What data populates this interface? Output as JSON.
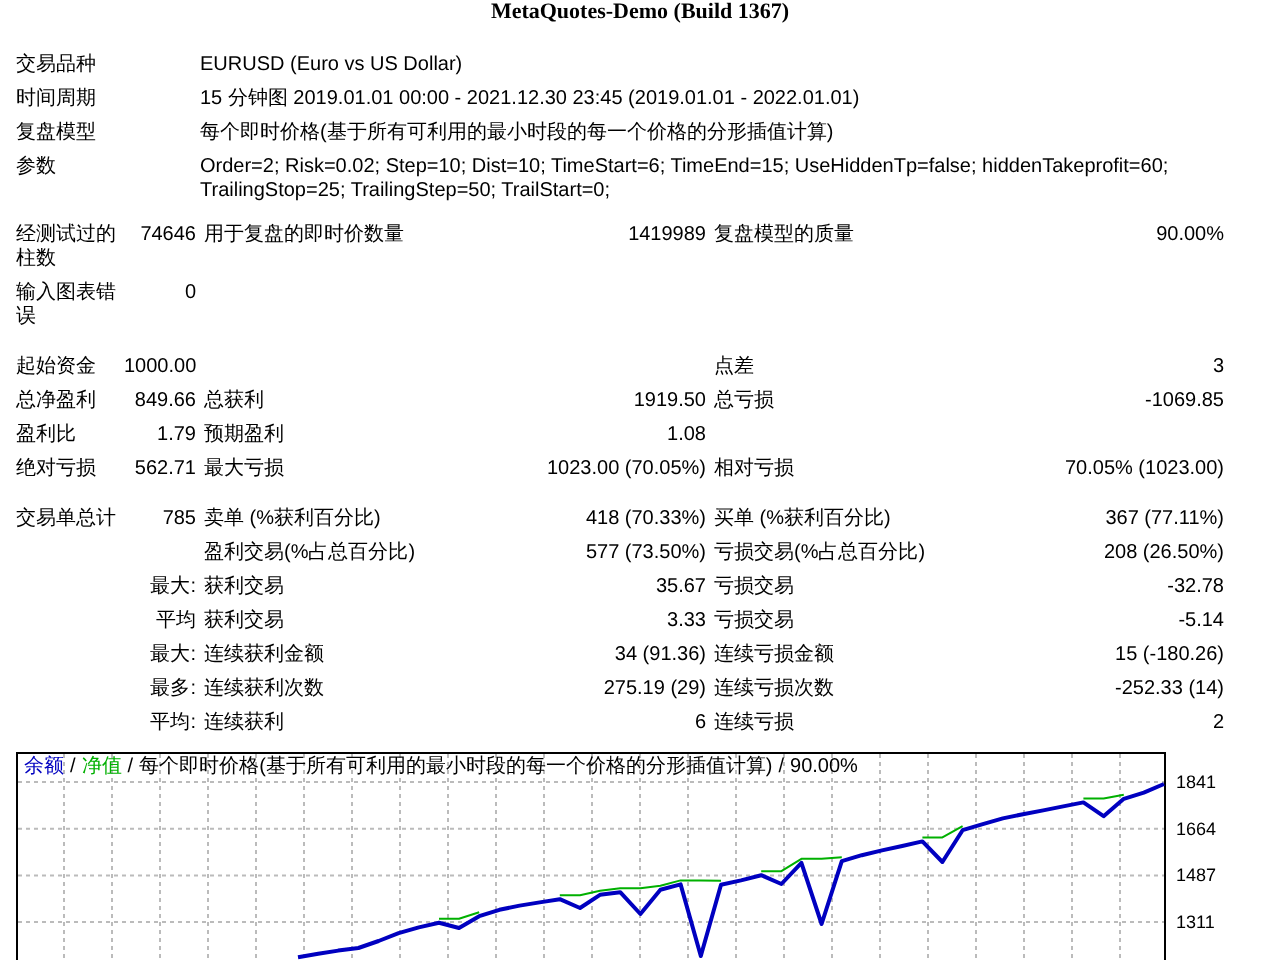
{
  "report_title": "MetaQuotes-Demo (Build 1367)",
  "info": [
    {
      "label": "交易品种",
      "value": "EURUSD (Euro vs US Dollar)"
    },
    {
      "label": "时间周期",
      "value": "15 分钟图 2019.01.01 00:00 - 2021.12.30 23:45 (2019.01.01 - 2022.01.01)"
    },
    {
      "label": "复盘模型",
      "value": "每个即时价格(基于所有可利用的最小时段的每一个价格的分形插值计算)"
    },
    {
      "label": "参数",
      "value": "Order=2; Risk=0.02; Step=10; Dist=10; TimeStart=6; TimeEnd=15; UseHiddenTp=false; hiddenTakeprofit=60; TrailingStop=25; TrailingStep=50; TrailStart=0;"
    }
  ],
  "sections": [
    [
      {
        "label": "经测试过的柱数",
        "value": "74646",
        "label_2": "用于复盘的即时价数量",
        "value_2": "1419989",
        "label_3": "复盘模型的质量",
        "value_3": "90.00%"
      },
      {
        "label": "输入图表错误",
        "value": "0"
      }
    ],
    [
      {
        "label": "起始资金",
        "value": "1000.00",
        "label_3": "点差",
        "value_3": "3"
      },
      {
        "label": "总净盈利",
        "value": "849.66",
        "label_2": "总获利",
        "value_2": "1919.50",
        "label_3": "总亏损",
        "value_3": "-1069.85"
      },
      {
        "label": "盈利比",
        "value": "1.79",
        "label_2": "预期盈利",
        "value_2": "1.08"
      },
      {
        "label": "绝对亏损",
        "value": "562.71",
        "label_2": "最大亏损",
        "value_2": "1023.00 (70.05%)",
        "label_3": "相对亏损",
        "value_3": "70.05% (1023.00)"
      }
    ],
    [
      {
        "label": "交易单总计",
        "value": "785",
        "label_2": "卖单 (%获利百分比)",
        "value_2": "418 (70.33%)",
        "label_3": "买单 (%获利百分比)",
        "value_3": "367 (77.11%)"
      },
      {
        "label_2": "盈利交易(%占总百分比)",
        "value_2": "577 (73.50%)",
        "label_3": "亏损交易(%占总百分比)",
        "value_3": "208 (26.50%)"
      },
      {
        "value": "最大:",
        "label_2": "获利交易",
        "value_2": "35.67",
        "label_3": "亏损交易",
        "value_3": "-32.78"
      },
      {
        "value": "平均",
        "label_2": "获利交易",
        "value_2": "3.33",
        "label_3": "亏损交易",
        "value_3": "-5.14"
      },
      {
        "value": "最大:",
        "label_2": "连续获利金额",
        "value_2": "34 (91.36)",
        "label_3": "连续亏损金额",
        "value_3": "15 (-180.26)"
      },
      {
        "value": "最多:",
        "label_2": "连续获利次数",
        "value_2": "275.19 (29)",
        "label_3": "连续亏损次数",
        "value_3": "-252.33 (14)"
      },
      {
        "value": "平均:",
        "label_2": "连续获利",
        "value_2": "6",
        "label_3": "连续亏损",
        "value_3": "2"
      }
    ]
  ],
  "chart": {
    "legend": [
      {
        "kind": "series"
      },
      {
        "kind": "separator",
        "text": "/"
      },
      {
        "kind": "series"
      },
      {
        "kind": "separator",
        "text": "/"
      },
      {
        "kind": "note",
        "text": "每个即时价格(基于所有可利用的最小时段的每一个价格的分形插值计算)"
      },
      {
        "kind": "separator",
        "text": "/"
      },
      {
        "kind": "note",
        "text": "90.00%"
      }
    ],
    "chart_data": {
      "type": "line",
      "ylim": [
        1174,
        1955
      ],
      "grid": true,
      "yticks": [
        {
          "value": 1841,
          "label": "1841"
        },
        {
          "value": 1664,
          "label": "1664"
        },
        {
          "value": 1487,
          "label": "1487"
        },
        {
          "value": 1311,
          "label": "1311"
        }
      ],
      "categories": [
        null,
        null,
        null,
        null,
        null,
        null,
        null,
        null,
        null,
        null,
        null,
        null,
        null,
        null,
        null,
        null,
        null,
        null,
        null,
        null,
        null,
        null,
        null,
        null,
        null,
        null,
        null,
        null,
        null,
        null,
        null,
        null,
        null,
        null,
        null,
        null,
        null,
        null,
        null,
        null,
        null,
        null,
        null,
        null,
        null,
        null,
        null,
        null,
        null,
        null,
        null,
        null,
        null,
        null,
        null,
        null,
        null,
        null
      ],
      "series": [
        {
          "name": "余额",
          "color": "#0000c0",
          "values": [
            null,
            null,
            null,
            null,
            null,
            null,
            null,
            null,
            null,
            null,
            null,
            null,
            null,
            null,
            1177,
            1190,
            1202,
            1212,
            1239,
            1268,
            1290,
            1308,
            1288,
            1333,
            1357,
            1373,
            1385,
            1397,
            1364,
            1414,
            1424,
            1341,
            1433,
            1453,
            1182,
            1452,
            1468,
            1488,
            1455,
            1535,
            1303,
            1541,
            1564,
            1582,
            1599,
            1616,
            1538,
            1659,
            1681,
            1703,
            1719,
            1734,
            1749,
            1764,
            1712,
            1778,
            1801,
            1834
          ]
        },
        {
          "name": "净值",
          "color": "#00b000",
          "values": [
            null,
            null,
            null,
            null,
            null,
            null,
            null,
            null,
            null,
            null,
            null,
            null,
            null,
            null,
            null,
            null,
            null,
            null,
            null,
            null,
            null,
            1323,
            1323,
            1348,
            null,
            null,
            null,
            1412,
            1412,
            1429,
            1439,
            1439,
            1448,
            1468,
            1468,
            1467,
            null,
            1503,
            1503,
            1550,
            1550,
            1556,
            null,
            null,
            null,
            1631,
            1631,
            1674,
            null,
            null,
            null,
            null,
            null,
            1779,
            1779,
            1793,
            null,
            null
          ]
        }
      ]
    }
  }
}
